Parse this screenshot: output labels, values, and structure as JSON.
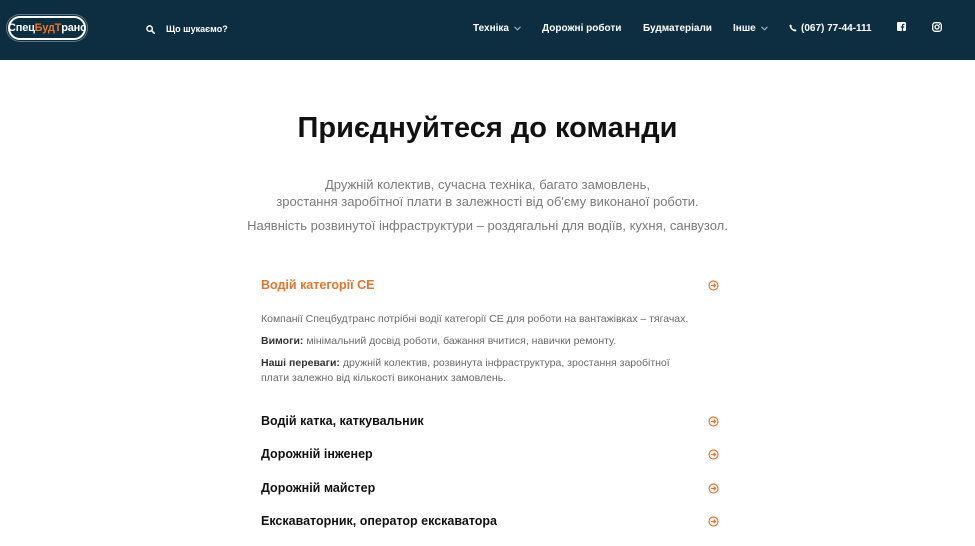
{
  "header": {
    "logo": {
      "part1": "Спец",
      "part2": "Буд",
      "part3": "Т",
      "part4": "ранс"
    },
    "search_label": "Що шукаємо?",
    "nav": {
      "tekhnika": "Техніка",
      "dorozhni_roboty": "Дорожні роботи",
      "budmaterialy": "Будматеріали",
      "inshe": "Інше",
      "phone": "(067) 77-44-111"
    },
    "social": {
      "facebook": "facebook-icon",
      "instagram": "instagram-icon"
    },
    "colors": {
      "background": "#0d2e40",
      "accent": "#e8742a"
    }
  },
  "hero": {
    "title": "Приєднуйтеся до команди",
    "intro_line1": "Дружній колектив, сучасна техніка, багато замовлень,",
    "intro_line2": "зростання заробітної плати в залежності від об'єму виконаної роботи.",
    "intro_line3": "Наявність розвинутої інфраструктури – роздягальні для водіїв, кухня, санвузол."
  },
  "vacancies": {
    "item1": {
      "title": "Водій категорії СЕ",
      "desc": "Компанії Спецбудтранс потрібні водії категорії СЕ для роботи на вантажівках – тягачах.",
      "req_label": "Вимоги:",
      "req_text": " мінімальний досвід роботи, бажання вчитися, навички ремонту.",
      "adv_label": "Наші переваги:",
      "adv_text_line1": " дружній колектив, розвинута інфраструктура, зростання заробітної",
      "adv_text_line2": "плати залежно від кількості виконаних замовлень."
    },
    "item2": {
      "title": "Водій катка, каткувальник"
    },
    "item3": {
      "title": "Дорожній інженер"
    },
    "item4": {
      "title": "Дорожній майстер"
    },
    "item5": {
      "title": "Екскаваторник, оператор екскаватора"
    }
  }
}
